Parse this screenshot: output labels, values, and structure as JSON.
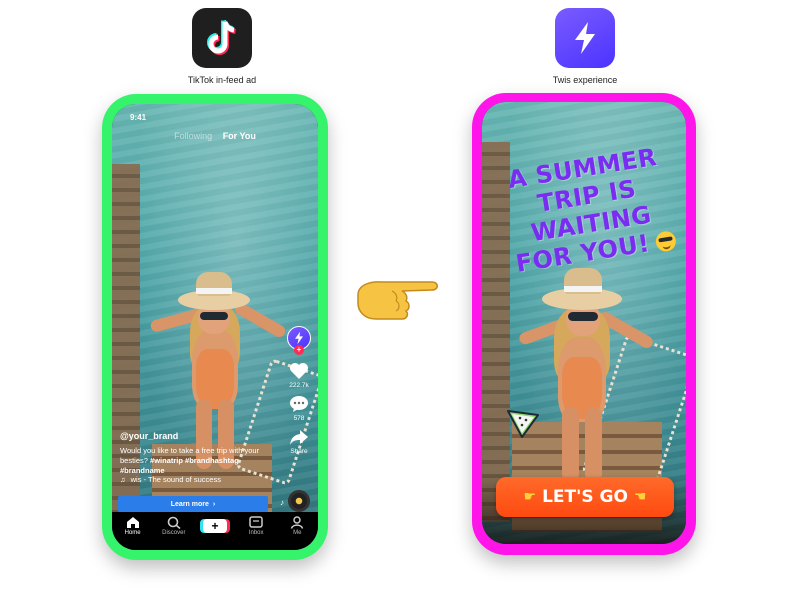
{
  "left_panel": {
    "caption": "TikTok in-feed ad",
    "icon": "tiktok-logo-icon",
    "frame_color": "#35f46c",
    "status_time": "9:41",
    "tabs": {
      "following": "Following",
      "for_you": "For You"
    },
    "like_count": "222.7k",
    "comment_count": "578",
    "share_label": "Share",
    "brand_handle": "@your_brand",
    "description": "Would you like to take a free trip with your besties?",
    "hashtags": "#winatrip #brandhashtag #brandname",
    "sound": "wis - The sound of success",
    "cta_label": "Learn more",
    "nav": [
      {
        "label": "Home",
        "icon": "home-icon"
      },
      {
        "label": "Discover",
        "icon": "search-icon"
      },
      {
        "label": "",
        "icon": "create-plus-icon"
      },
      {
        "label": "Inbox",
        "icon": "inbox-icon"
      },
      {
        "label": "Me",
        "icon": "profile-icon"
      }
    ]
  },
  "right_panel": {
    "caption": "Twis experience",
    "icon": "twis-bolt-icon",
    "frame_color": "#ff14ea",
    "headline": "A SUMMER TRIP IS WAITING FOR YOU!",
    "headline_color": "#7b2cf2",
    "cta_label": "LET'S GO",
    "cta_color": "#ff5a1f"
  },
  "middle": {
    "icon": "pointing-hand-icon"
  }
}
